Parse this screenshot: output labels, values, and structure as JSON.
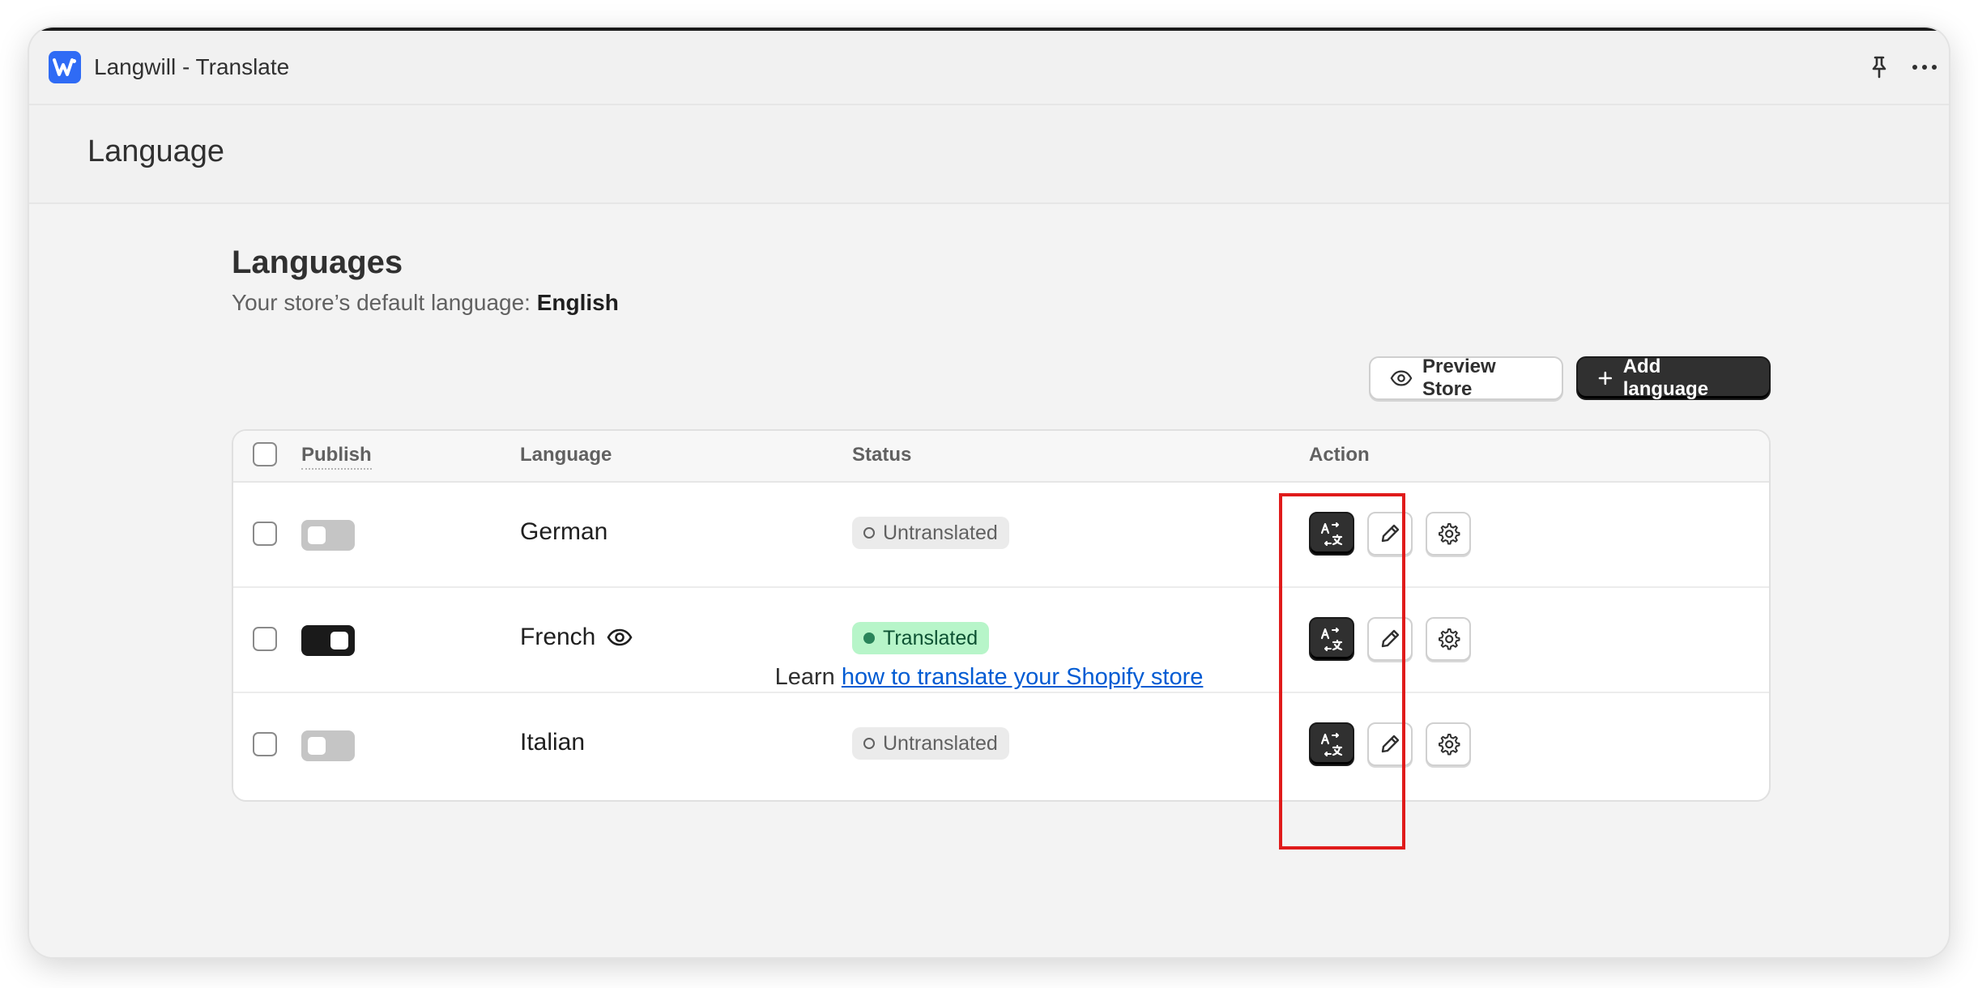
{
  "app": {
    "title": "Langwill - Translate",
    "logo_letter": "W",
    "brand_color": "#2f6bf5"
  },
  "titlebar_icons": [
    "pin-icon",
    "more-horizontal-icon"
  ],
  "page": {
    "title": "Language"
  },
  "section": {
    "title": "Languages",
    "default_prefix": "Your store’s default language: ",
    "default_language": "English"
  },
  "buttons": {
    "preview_store": "Preview Store",
    "add_language": "Add language"
  },
  "table": {
    "headers": {
      "publish": "Publish",
      "language": "Language",
      "status": "Status",
      "action": "Action"
    },
    "rows": [
      {
        "language": "German",
        "published": false,
        "status": "Untranslated",
        "preview_icon": false
      },
      {
        "language": "French",
        "published": true,
        "status": "Translated",
        "preview_icon": true
      },
      {
        "language": "Italian",
        "published": false,
        "status": "Untranslated",
        "preview_icon": false
      }
    ]
  },
  "footer": {
    "prefix": "Learn ",
    "link_text": "how to translate your Shopify store"
  },
  "colors": {
    "primary_button": "#303030",
    "translated_badge": "#b7f5c9",
    "untranslated_badge": "#ebebeb",
    "link": "#005bd3",
    "highlight": "#e01b1b"
  }
}
